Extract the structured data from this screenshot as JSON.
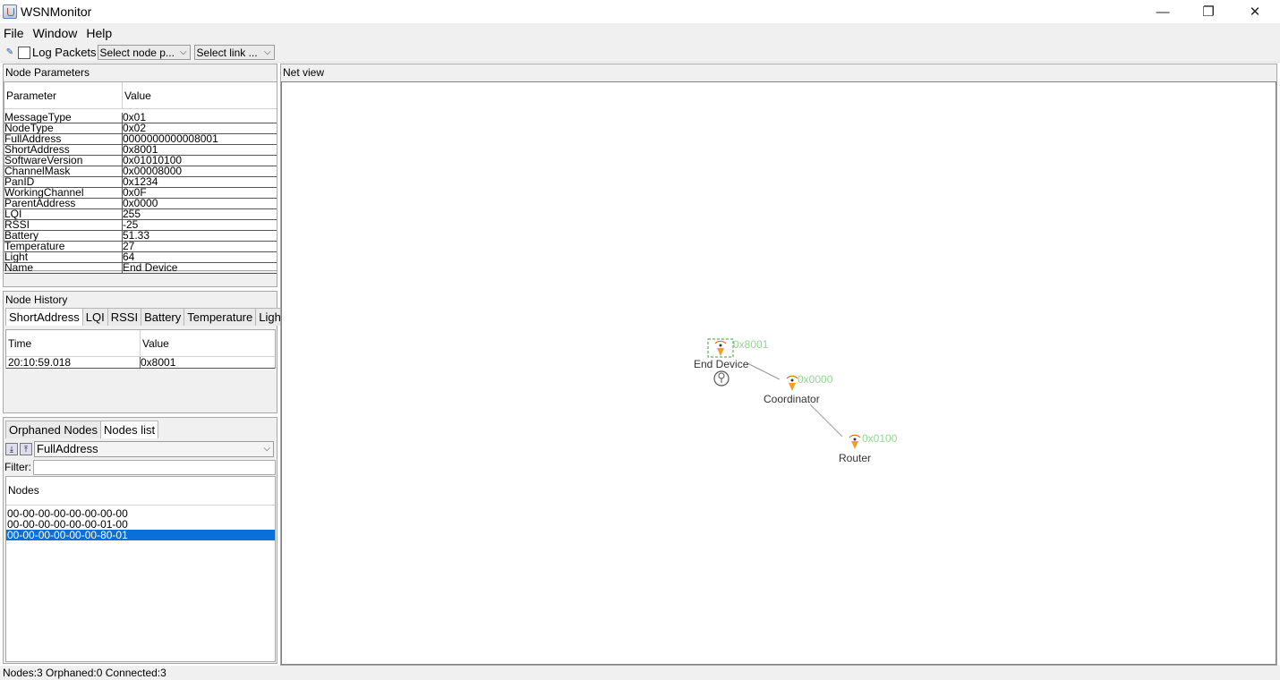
{
  "window": {
    "title": "WSNMonitor",
    "minimize": "—",
    "restore": "❐",
    "close": "✕"
  },
  "menu": {
    "items": [
      "File",
      "Window",
      "Help"
    ]
  },
  "toolbar": {
    "log_label": "Log Packets",
    "node_select": "Select node p...",
    "link_select": "Select link ..."
  },
  "node_parameters": {
    "title": "Node Parameters",
    "columns": [
      "Parameter",
      "Value"
    ],
    "rows": [
      [
        "MessageType",
        "0x01"
      ],
      [
        "NodeType",
        "0x02"
      ],
      [
        "FullAddress",
        "0000000000008001"
      ],
      [
        "ShortAddress",
        "0x8001"
      ],
      [
        "SoftwareVersion",
        "0x01010100"
      ],
      [
        "ChannelMask",
        "0x00008000"
      ],
      [
        "PanID",
        "0x1234"
      ],
      [
        "WorkingChannel",
        "0x0F"
      ],
      [
        "ParentAddress",
        "0x0000"
      ],
      [
        "LQI",
        "255"
      ],
      [
        "RSSI",
        "-25"
      ],
      [
        "Battery",
        "51.33"
      ],
      [
        "Temperature",
        "27"
      ],
      [
        "Light",
        "64"
      ],
      [
        "Name",
        "End Device"
      ]
    ]
  },
  "node_history": {
    "title": "Node History",
    "tabs": [
      "ShortAddress",
      "LQI",
      "RSSI",
      "Battery",
      "Temperature",
      "Light"
    ],
    "active_tab": "ShortAddress",
    "columns": [
      "Time",
      "Value"
    ],
    "rows": [
      [
        "20:10:59.018",
        "0x8001"
      ]
    ]
  },
  "nodes_panel": {
    "tabs": [
      "Orphaned Nodes",
      "Nodes list"
    ],
    "active_tab": "Nodes list",
    "sort_select": "FullAddress",
    "filter_label": "Filter:",
    "filter_value": "",
    "column": "Nodes",
    "items": [
      "00-00-00-00-00-00-00-00",
      "00-00-00-00-00-00-01-00",
      "00-00-00-00-00-00-80-01"
    ],
    "selected_index": 2
  },
  "net_view": {
    "title": "Net view",
    "nodes": [
      {
        "name": "End Device",
        "address": "0x8001"
      },
      {
        "name": "Coordinator",
        "address": "0x0000"
      },
      {
        "name": "Router",
        "address": "0x0100"
      }
    ]
  },
  "status": {
    "text": "Nodes:3  Orphaned:0  Connected:3"
  }
}
